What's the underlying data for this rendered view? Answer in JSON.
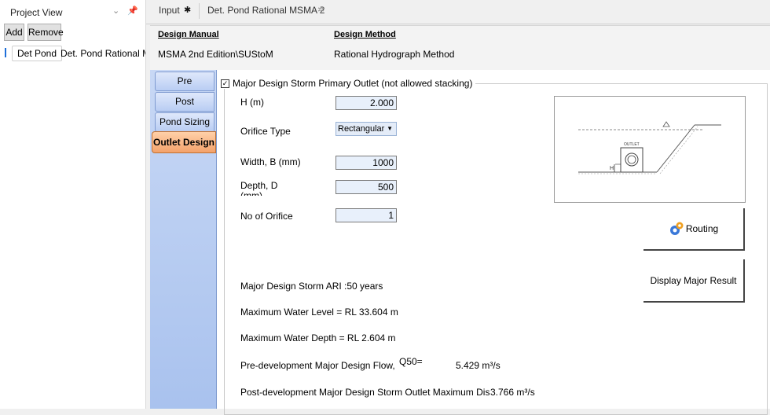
{
  "project_panel": {
    "title": "Project View",
    "add_label": "Add",
    "remove_label": "Remove",
    "tree_key": "Det Pond",
    "tree_value": "Det. Pond Rational MS"
  },
  "tabs": {
    "input": "Input",
    "document": "Det. Pond Rational MSMA 2"
  },
  "design": {
    "manual_label": "Design Manual",
    "manual_value": "MSMA 2nd Edition\\SUStoM",
    "method_label": "Design Method",
    "method_value": "Rational Hydrograph Method"
  },
  "vertical_tabs": [
    "Pre",
    "Post",
    "Pond Sizing",
    "Outlet Design"
  ],
  "outlet": {
    "group_title": "Major Design Storm Primary Outlet (not allowed stacking)",
    "h_label": "H (m)",
    "h_value": "2.000",
    "orifice_type_label": "Orifice Type",
    "orifice_type_value": "Rectangular",
    "width_label": "Width, B (mm)",
    "width_value": "1000",
    "depth_label": "Depth, D",
    "depth_label2": "(mm)",
    "depth_value": "500",
    "count_label": "No of Orifice",
    "count_value": "1",
    "diagram_text": "OUTLET",
    "routing_label": "Routing",
    "major_result_label": "Display Major Result",
    "ari_text": "Major Design Storm ARI :50 years",
    "max_level_text": "Maximum Water Level =  RL 33.604 m",
    "max_depth_text": "Maximum Water Depth =  RL 2.604 m",
    "pre_flow_label": "Pre-development Major Design Flow,",
    "q_symbol": "Q50=",
    "pre_flow_value": "5.429 m³/s",
    "post_label": "Post-development Major Design Storm Outlet Maximum Discharg",
    "post_value": "3.766 m³/s"
  }
}
